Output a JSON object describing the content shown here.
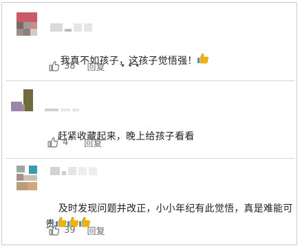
{
  "comments": [
    {
      "text": "我真不如孩子，这孩子觉悟强！",
      "emoji": [
        "thumbs-up"
      ],
      "likes": "38",
      "reply_label": "回复",
      "more_label": "•••"
    },
    {
      "text": "赶紧收藏起来，晚上给孩子看看",
      "emoji": [],
      "likes": "4",
      "reply_label": "回复"
    },
    {
      "text": "及时发现问题并改正，小小年纪有此觉悟，真是难能可贵",
      "emoji": [
        "thumbs-up",
        "thumbs-up",
        "thumbs-up"
      ],
      "likes": "39",
      "reply_label": "回复"
    }
  ],
  "colors": {
    "text": "#1f1f1f",
    "action_text": "#6b6b6b",
    "separator": "#d6d6d6",
    "thumb_emoji": "#f2b200"
  }
}
